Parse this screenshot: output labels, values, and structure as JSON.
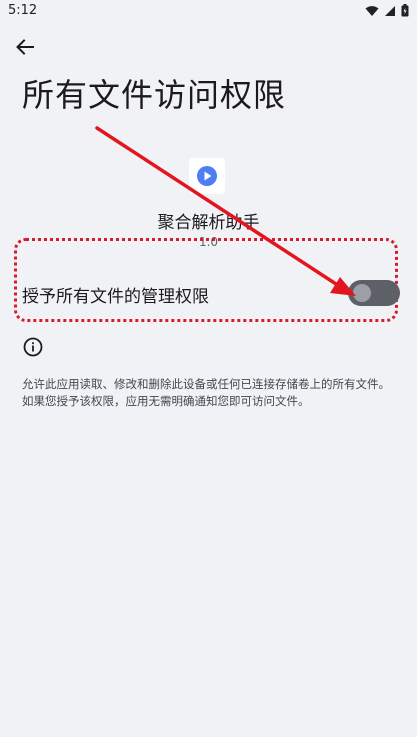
{
  "status_bar": {
    "time": "5:12",
    "icons": [
      "wifi-icon",
      "signal-icon",
      "battery-icon"
    ]
  },
  "header": {
    "back_icon": "arrow-left-icon",
    "title": "所有文件访问权限"
  },
  "app": {
    "icon": "play-icon",
    "name": "聚合解析助手",
    "version": "1.0"
  },
  "permission": {
    "label": "授予所有文件的管理权限",
    "toggle_on": false
  },
  "info": {
    "icon": "info-icon",
    "description": "允许此应用读取、修改和删除此设备或任何已连接存储卷上的所有文件。如果您授予该权限，应用无需明确通知您即可访问文件。"
  },
  "colors": {
    "background": "#f1f2f6",
    "annotation_red": "#d61c2c",
    "toggle_track": "#5d6167",
    "app_icon_blue": "#4f7df3"
  }
}
